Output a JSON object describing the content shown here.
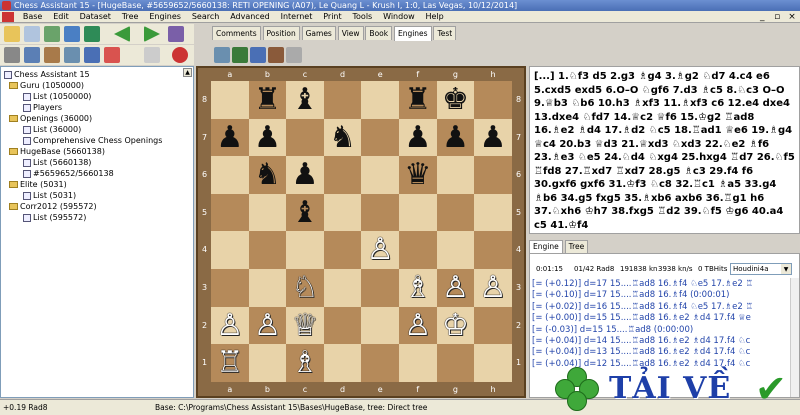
{
  "window": {
    "title": "Chess Assistant 15 - [HugeBase, #5659652/5660138: RETI OPENING (A07), Le Quang L - Krush I, 1:0, Las Vegas, 10/12/2014]",
    "controls": [
      "_",
      "▫",
      "×"
    ]
  },
  "menu": [
    "Base",
    "Edit",
    "Dataset",
    "Tree",
    "Engines",
    "Search",
    "Advanced",
    "Internet",
    "Print",
    "Tools",
    "Window",
    "Help"
  ],
  "right_tabs": [
    "Comments",
    "Position",
    "Games",
    "View",
    "Book",
    "Engines",
    "Test"
  ],
  "right_tabs_active": "Engines",
  "tree": [
    {
      "label": "Chess Assistant 15",
      "type": "root"
    },
    {
      "label": "Guru (1050000)",
      "type": "base"
    },
    {
      "label": "List (1050000)",
      "type": "list"
    },
    {
      "label": "Players",
      "type": "list"
    },
    {
      "label": "Openings (36000)",
      "type": "base"
    },
    {
      "label": "List (36000)",
      "type": "list"
    },
    {
      "label": "Comprehensive Chess Openings",
      "type": "list"
    },
    {
      "label": "HugeBase (5660138)",
      "type": "base"
    },
    {
      "label": "List (5660138)",
      "type": "list"
    },
    {
      "label": "#5659652/5660138",
      "type": "list",
      "selected": true
    },
    {
      "label": "Elite (5031)",
      "type": "base"
    },
    {
      "label": "List (5031)",
      "type": "list"
    },
    {
      "label": "Corr2012 (595572)",
      "type": "base"
    },
    {
      "label": "List (595572)",
      "type": "list"
    }
  ],
  "board": {
    "files": [
      "a",
      "b",
      "c",
      "d",
      "e",
      "f",
      "g",
      "h"
    ],
    "ranks": [
      "8",
      "7",
      "6",
      "5",
      "4",
      "3",
      "2",
      "1"
    ],
    "pieces": [
      {
        "square": "b8",
        "glyph": "♜",
        "color": "b"
      },
      {
        "square": "c8",
        "glyph": "♝",
        "color": "b"
      },
      {
        "square": "f8",
        "glyph": "♜",
        "color": "b"
      },
      {
        "square": "g8",
        "glyph": "♚",
        "color": "b"
      },
      {
        "square": "a7",
        "glyph": "♟",
        "color": "b"
      },
      {
        "square": "b7",
        "glyph": "♟",
        "color": "b"
      },
      {
        "square": "d7",
        "glyph": "♞",
        "color": "b"
      },
      {
        "square": "f7",
        "glyph": "♟",
        "color": "b"
      },
      {
        "square": "g7",
        "glyph": "♟",
        "color": "b"
      },
      {
        "square": "h7",
        "glyph": "♟",
        "color": "b"
      },
      {
        "square": "b6",
        "glyph": "♞",
        "color": "b"
      },
      {
        "square": "c6",
        "glyph": "♟",
        "color": "b"
      },
      {
        "square": "f6",
        "glyph": "♛",
        "color": "b"
      },
      {
        "square": "c5",
        "glyph": "♝",
        "color": "b"
      },
      {
        "square": "e4",
        "glyph": "♙",
        "color": "w"
      },
      {
        "square": "c3",
        "glyph": "♘",
        "color": "w"
      },
      {
        "square": "f3",
        "glyph": "♗",
        "color": "w"
      },
      {
        "square": "g3",
        "glyph": "♙",
        "color": "w"
      },
      {
        "square": "h3",
        "glyph": "♙",
        "color": "w"
      },
      {
        "square": "a2",
        "glyph": "♙",
        "color": "w"
      },
      {
        "square": "b2",
        "glyph": "♙",
        "color": "w"
      },
      {
        "square": "c2",
        "glyph": "♕",
        "color": "w"
      },
      {
        "square": "f2",
        "glyph": "♙",
        "color": "w"
      },
      {
        "square": "g2",
        "glyph": "♔",
        "color": "w"
      },
      {
        "square": "a1",
        "glyph": "♖",
        "color": "w"
      },
      {
        "square": "c1",
        "glyph": "♗",
        "color": "w"
      }
    ]
  },
  "notation": "[...] 1.♘f3 d5 2.g3 ♗g4 3.♗g2 ♘d7 4.c4 e6 5.cxd5 exd5 6.O–O ♘gf6 7.d3 ♗c5 8.♘c3 O–O 9.♕b3 ♘b6 10.h3 ♗xf3 11.♗xf3 c6 12.e4 dxe4 13.dxe4 ♘fd7 14.♕c2 ♕f6 15.♔g2 ♖ad8 16.♗e2 ♗d4 17.♗d2 ♘c5 18.♖ad1 ♕e6 19.♗g4 ♕c4 20.b3 ♕d3 21.♕xd3 ♘xd3 22.♘e2 ♗f6 23.♗e3 ♘e5 24.♘d4 ♘xg4 25.hxg4 ♖d7 26.♘f5 ♖fd8 27.♖xd7 ♖xd7 28.g5 ♗c3 29.f4 f6 30.gxf6 gxf6 31.♔f3 ♘c8 32.♖c1 ♗a5 33.g4 ♗b6 34.g5 fxg5 35.♗xb6 axb6 36.♖g1 h6 37.♘xh6 ♔h7 38.fxg5 ♖d2 39.♘f5 ♔g6 40.a4 c5 41.♔f4",
  "engine_tabs": [
    "Engine",
    "Tree"
  ],
  "engine_tabs_active": "Engine",
  "engine_status": {
    "time": "0:01:15",
    "move": "01/42 Rad8",
    "nodes": "191838 kn",
    "speed": "3938 kn/s",
    "tb": "0 TBHits",
    "engine_name": "Houdini4a"
  },
  "pv_lines": [
    "[= (+0.12)] d=17  15....♖ad8 16.♗f4 ♘e5 17.♗e2 ♖",
    "[= (+0.10)] d=17  15....♖ad8 16.♗f4 (0:00:01)",
    "[= (+0.02)] d=16  15....♖ad8 16.♗f4 ♘e5 17.♗e2 ♖",
    "[= (+0.00)] d=15  15....♖ad8 16.♗e2 ♗d4 17.f4 ♕e",
    "[= (-0.03)] d=15  15....♖ad8 (0:00:00)",
    "[= (+0.04)] d=14  15....♖ad8 16.♗e2 ♗d4 17.f4 ♘c",
    "[= (+0.04)] d=13  15....♖ad8 16.♗e2 ♗d4 17.f4 ♘c",
    "[= (+0.04)] d=12  15....♖ad8 16.♗e2 ♗d4 17.f4 ♘c"
  ],
  "statusbar": {
    "left": "+0.19 Rad8",
    "base": "Base: C:\\Programs\\Chess Assistant 15\\Bases\\HugeBase, tree: Direct tree"
  },
  "watermark": {
    "text": "TẢI VỀ",
    "check": "✔"
  },
  "colors": {
    "light_square": "#e8d3a9",
    "dark_square": "#b58a5a",
    "selection": "#316ac5",
    "pv_text": "#2244aa"
  }
}
